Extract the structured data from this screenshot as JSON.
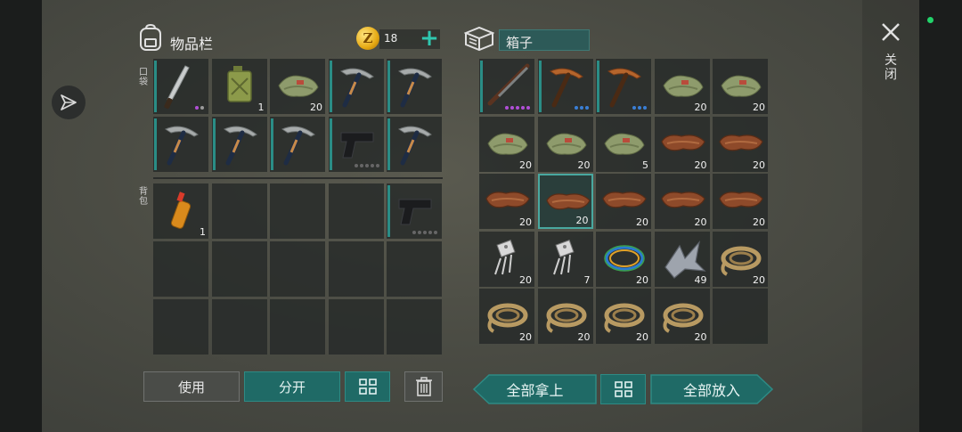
{
  "left_panel": {
    "title": "物品栏",
    "coins": "18",
    "plus_label": "+",
    "pocket_label": "口袋",
    "backpack_label": "背包"
  },
  "right_panel": {
    "title": "箱子"
  },
  "close": {
    "label": "关闭"
  },
  "pocket_items": [
    {
      "name": "machete",
      "qty": "",
      "dots": [
        "#b04fd6",
        "#9a9a9a"
      ]
    },
    {
      "name": "jerry-can",
      "qty": "1",
      "dots": []
    },
    {
      "name": "cloth",
      "qty": "20",
      "dots": []
    },
    {
      "name": "pickaxe",
      "qty": "",
      "dots": []
    },
    {
      "name": "pickaxe",
      "qty": "",
      "dots": []
    },
    {
      "name": "pickaxe",
      "qty": "",
      "dots": []
    },
    {
      "name": "pickaxe",
      "qty": "",
      "dots": []
    },
    {
      "name": "pickaxe",
      "qty": "",
      "dots": []
    },
    {
      "name": "pistol",
      "qty": "",
      "dots": [
        "#666",
        "#666",
        "#666",
        "#666",
        "#666"
      ]
    },
    {
      "name": "pickaxe",
      "qty": "",
      "dots": []
    }
  ],
  "backpack_items": [
    {
      "name": "bottle",
      "qty": "1",
      "dots": []
    },
    {
      "name": "empty",
      "qty": "",
      "dots": []
    },
    {
      "name": "empty",
      "qty": "",
      "dots": []
    },
    {
      "name": "empty",
      "qty": "",
      "dots": []
    },
    {
      "name": "pistol",
      "qty": "",
      "dots": [
        "#666",
        "#666",
        "#666",
        "#666",
        "#666"
      ]
    },
    {
      "name": "empty",
      "qty": "",
      "dots": []
    },
    {
      "name": "empty",
      "qty": "",
      "dots": []
    },
    {
      "name": "empty",
      "qty": "",
      "dots": []
    },
    {
      "name": "empty",
      "qty": "",
      "dots": []
    },
    {
      "name": "empty",
      "qty": "",
      "dots": []
    },
    {
      "name": "empty",
      "qty": "",
      "dots": []
    },
    {
      "name": "empty",
      "qty": "",
      "dots": []
    },
    {
      "name": "empty",
      "qty": "",
      "dots": []
    },
    {
      "name": "empty",
      "qty": "",
      "dots": []
    },
    {
      "name": "empty",
      "qty": "",
      "dots": []
    }
  ],
  "box_items": [
    {
      "name": "shotgun",
      "qty": "",
      "dots": [
        "#b04fd6",
        "#b04fd6",
        "#b04fd6",
        "#b04fd6",
        "#b04fd6"
      ]
    },
    {
      "name": "pickaxe-copper",
      "qty": "",
      "dots": [
        "#3a7fd6",
        "#3a7fd6",
        "#3a7fd6"
      ]
    },
    {
      "name": "pickaxe-copper",
      "qty": "",
      "dots": [
        "#3a7fd6",
        "#3a7fd6",
        "#3a7fd6"
      ]
    },
    {
      "name": "cloth",
      "qty": "20",
      "dots": []
    },
    {
      "name": "cloth",
      "qty": "20",
      "dots": []
    },
    {
      "name": "cloth",
      "qty": "20",
      "dots": []
    },
    {
      "name": "cloth",
      "qty": "20",
      "dots": []
    },
    {
      "name": "cloth",
      "qty": "5",
      "dots": []
    },
    {
      "name": "leather",
      "qty": "20",
      "dots": []
    },
    {
      "name": "leather",
      "qty": "20",
      "dots": []
    },
    {
      "name": "leather",
      "qty": "20",
      "dots": []
    },
    {
      "name": "leather",
      "qty": "20",
      "dots": []
    },
    {
      "name": "leather",
      "qty": "20",
      "dots": []
    },
    {
      "name": "leather",
      "qty": "20",
      "dots": []
    },
    {
      "name": "leather",
      "qty": "20",
      "dots": []
    },
    {
      "name": "transistor",
      "qty": "20",
      "dots": []
    },
    {
      "name": "transistor",
      "qty": "7",
      "dots": []
    },
    {
      "name": "wires",
      "qty": "20",
      "dots": []
    },
    {
      "name": "scrap-metal",
      "qty": "49",
      "dots": []
    },
    {
      "name": "rope",
      "qty": "20",
      "dots": []
    },
    {
      "name": "rope",
      "qty": "20",
      "dots": []
    },
    {
      "name": "rope",
      "qty": "20",
      "dots": []
    },
    {
      "name": "rope",
      "qty": "20",
      "dots": []
    },
    {
      "name": "rope",
      "qty": "20",
      "dots": []
    },
    {
      "name": "empty",
      "qty": "",
      "dots": []
    }
  ],
  "buttons": {
    "use": "使用",
    "split": "分开",
    "take_all": "全部拿上",
    "put_all": "全部放入"
  },
  "colors": {
    "accent": "#1f6a66",
    "highlight": "#2fc7b0",
    "status": "#22d36a"
  }
}
